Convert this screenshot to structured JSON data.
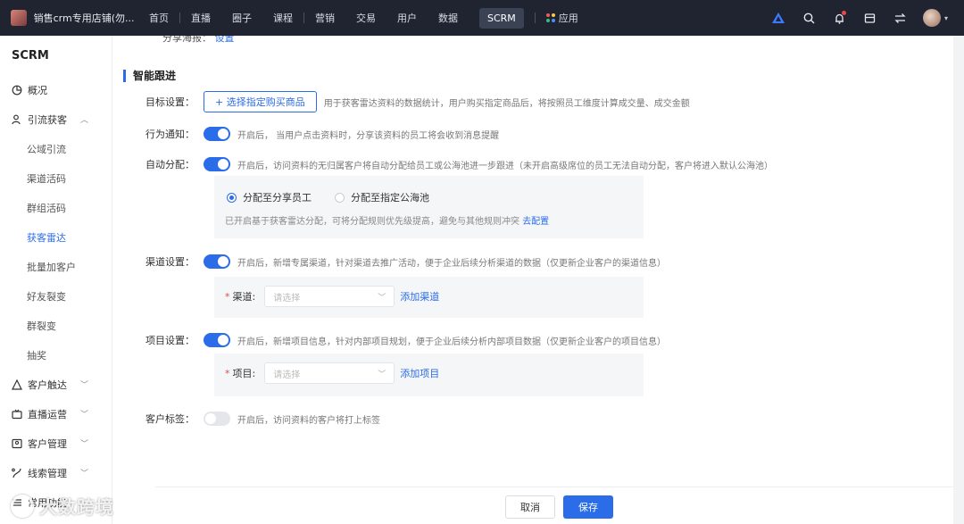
{
  "topbar": {
    "brand_name": "销售crm专用店铺(勿...",
    "nav": [
      "首页",
      "直播",
      "圈子",
      "课程",
      "营销",
      "交易",
      "用户",
      "数据",
      "SCRM",
      "应用"
    ],
    "active_nav": "SCRM"
  },
  "sidebar": {
    "title": "SCRM",
    "overview": "概况",
    "lead_group": "引流获客",
    "lead_items": [
      "公域引流",
      "渠道活码",
      "群组活码",
      "获客雷达",
      "批量加客户",
      "好友裂变",
      "群裂变",
      "抽奖"
    ],
    "active_item": "获客雷达",
    "groups_after": [
      "客户触达",
      "直播运营",
      "客户管理",
      "线索管理",
      "常用功能"
    ]
  },
  "main": {
    "cut_row_label": "分享海报：",
    "cut_row_link": "设置",
    "section_title": "智能跟进",
    "target": {
      "label": "目标设置：",
      "button": "+ 选择指定购买商品",
      "desc": "用于获客雷达资料的数据统计，用户购买指定商品后，将按照员工维度计算成交量、成交金额"
    },
    "behavior": {
      "label": "行为通知：",
      "on": true,
      "desc": "开启后， 当用户点击资料时，分享该资料的员工将会收到消息提醒"
    },
    "auto_assign": {
      "label": "自动分配：",
      "on": true,
      "desc": "开启后，访问资料的无归属客户将自动分配给员工或公海池进一步跟进（未开启高级席位的员工无法自动分配，客户将进入默认公海池）",
      "options": [
        "分配至分享员工",
        "分配至指定公海池"
      ],
      "selected": "分配至分享员工",
      "tip": "已开启基于获客雷达分配，可将分配规则优先级提高，避免与其他规则冲突",
      "tip_link": "去配置"
    },
    "channel": {
      "label": "渠道设置：",
      "on": true,
      "desc": "开启后，新增专属渠道，针对渠道去推广活动，便于企业后续分析渠道的数据（仅更新企业客户的渠道信息）",
      "field_label": "渠道:",
      "placeholder": "请选择",
      "add_link": "添加渠道"
    },
    "project": {
      "label": "项目设置：",
      "on": true,
      "desc": "开启后，新增项目信息，针对内部项目规划，便于企业后续分析内部项目数据（仅更新企业客户的项目信息）",
      "field_label": "项目:",
      "placeholder": "请选择",
      "add_link": "添加项目"
    },
    "tags": {
      "label": "客户标签：",
      "on": false,
      "desc": "开启后，访问资料的客户将打上标签"
    }
  },
  "footer": {
    "cancel": "取消",
    "save": "保存"
  },
  "watermark": "大数跨境",
  "colors": {
    "accent": "#2b6de8",
    "topbar": "#1f2430"
  }
}
